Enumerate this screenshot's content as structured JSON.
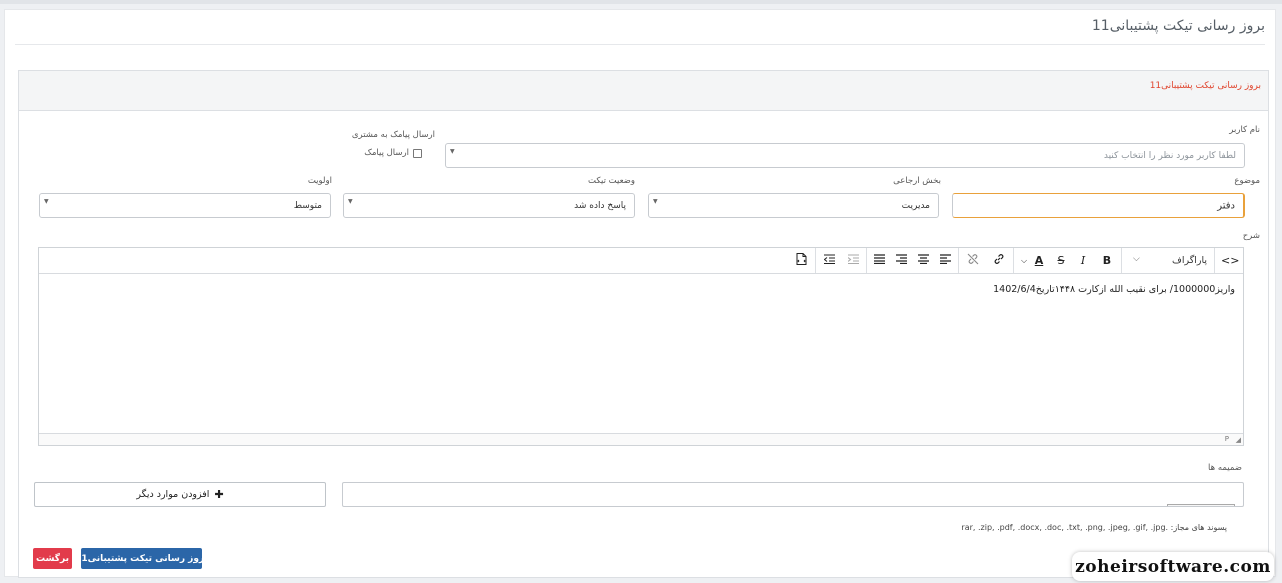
{
  "page": {
    "title": "بروز رسانی تیکت پشتیبانی11"
  },
  "panel": {
    "header": "بروز رسانی تیکت پشتیبانی11"
  },
  "form": {
    "username": {
      "label": "نام کاربر",
      "placeholder": "لطفا کاربر مورد نظر را انتخاب کنید"
    },
    "sms": {
      "label": "ارسال پیامک به مشتری",
      "checkbox_label": "ارسال پیامک",
      "checked": false
    },
    "subject": {
      "label": "موضوع",
      "value": "دفتر"
    },
    "department": {
      "label": "بخش ارجاعی",
      "value": "مدیریت"
    },
    "status": {
      "label": "وضعیت تیکت",
      "value": "پاسخ داده شد"
    },
    "priority": {
      "label": "اولویت",
      "value": "متوسط"
    },
    "description": {
      "label": "شرح",
      "content": "واریز1000000/ برای نقیب الله ازکارت ۱۴۴۸تاریخ1402/6/4"
    },
    "attachments": {
      "label": "ضمیمه ها",
      "add_more": "افزودن موارد دیگر"
    },
    "allowed_ext": "پسوند های مجاز: .rar, .zip, .pdf, .docx, .doc, .txt, .png, .jpeg, .gif, .jpg"
  },
  "editor": {
    "paragraph_label": "پاراگراف",
    "status_path": "P",
    "toolbar": [
      "source-code",
      "paragraph-format",
      "bold",
      "italic",
      "strikethrough",
      "text-color",
      "link",
      "unlink",
      "align-left",
      "align-center",
      "align-right",
      "justify",
      "indent",
      "outdent",
      "template"
    ]
  },
  "buttons": {
    "update": "بروز رسانی تیکت پشتیبانی11",
    "back": "برگشت"
  },
  "watermark": "zoheirsoftware.com",
  "colors": {
    "primary": "#2b66a8",
    "danger": "#e23b4b",
    "header_accent": "#e0442d",
    "focus": "#e9a13b"
  }
}
